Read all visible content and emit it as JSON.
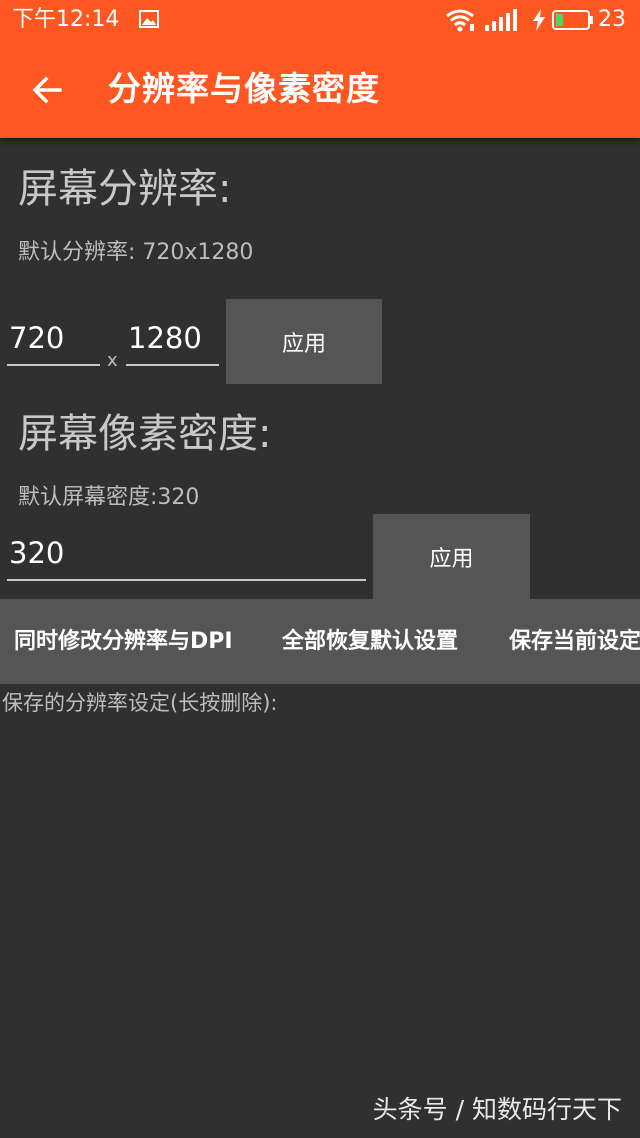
{
  "status_bar": {
    "time": "下午12:14",
    "battery_level": "23",
    "battery_fraction": 0.23,
    "icons": [
      "image-icon",
      "wifi-icon",
      "signal-icon",
      "charging-bolt-icon",
      "battery-icon"
    ]
  },
  "app_bar": {
    "title": "分辨率与像素密度",
    "back_icon": "arrow-left-icon",
    "color": "#ff5722"
  },
  "resolution": {
    "title": "屏幕分辨率:",
    "default_hint": "默认分辨率: 720x1280",
    "width_value": "720",
    "height_value": "1280",
    "separator": "x",
    "apply_label": "应用"
  },
  "density": {
    "title": "屏幕像素密度:",
    "default_hint": "默认屏幕密度:320",
    "value": "320",
    "apply_label": "应用"
  },
  "actions": {
    "modify_both": "同时修改分辨率与DPI",
    "restore_defaults": "全部恢复默认设置",
    "save_current": "保存当前设定"
  },
  "saved": {
    "label": "保存的分辨率设定(长按删除):"
  },
  "watermark": "头条号 / 知数码行天下",
  "colors": {
    "background": "#303030",
    "button": "#555555",
    "accent": "#ff5722"
  }
}
